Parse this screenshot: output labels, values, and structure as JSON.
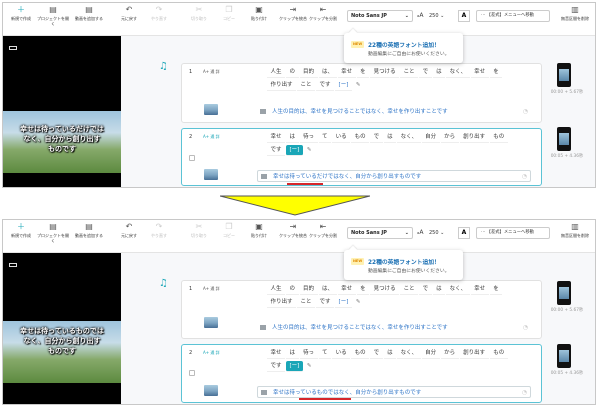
{
  "toolbar": {
    "new_project": "新規で作成",
    "open_project": "プロジェクトを開く",
    "add_video": "動画を追加する",
    "undo": "元に戻す",
    "redo": "やり直す",
    "cut": "切り取り",
    "copy": "コピー",
    "paste": "貼り付け",
    "clip_merge": "クリップを統合",
    "clip_split": "クリップを分割",
    "font": "Noto Sans JP",
    "font_size": "250",
    "color_btn": "A",
    "menu_btn": "【差式】メニューへ移動",
    "silence": "無音区間を削除"
  },
  "popup": {
    "badge": "NEW",
    "title": "22種の英語フォント追加！",
    "body": "動画編集にご自由にお使いください。"
  },
  "arrow_color": "#ffff00",
  "accent": "#1aa6b7",
  "before": {
    "overlay_lines": [
      "幸せは待っているだけでは",
      "なく、自分から創り出す",
      "ものです"
    ],
    "clip1": {
      "num": "1",
      "mode": "A+ 通 詳",
      "words": [
        "人生",
        "の",
        "目的",
        "は、",
        "幸せ",
        "を",
        "見つける",
        "こと",
        "で",
        "は",
        "なく、",
        "幸せ",
        "を",
        "作り出す",
        "こと",
        "です",
        "[ー]"
      ],
      "subtitle": "人生の目的は、幸せを見つけることではなく、幸せを作り出すことです",
      "duration": "00:00 + 5.67秒"
    },
    "clip2": {
      "num": "2",
      "mode": "A+ 通 詳",
      "words": [
        "幸せ",
        "は",
        "待っ",
        "て",
        "いる",
        "もの",
        "で",
        "は",
        "なく、",
        "自分",
        "から",
        "創り出す",
        "もの",
        "です",
        "[ー]"
      ],
      "subtitle": "幸せは待っているだけではなく、自分から創り出すものです",
      "duration": "00:05 + 4.36秒"
    }
  },
  "after": {
    "overlay_lines": [
      "幸せは待っているものでは",
      "なく、自分から創り出す",
      "ものです"
    ],
    "clip1": {
      "num": "1",
      "mode": "A+ 通 詳",
      "words": [
        "人生",
        "の",
        "目的",
        "は、",
        "幸せ",
        "を",
        "見つける",
        "こと",
        "で",
        "は",
        "なく、",
        "幸せ",
        "を",
        "作り出す",
        "こと",
        "です",
        "[ー]"
      ],
      "subtitle": "人生の目的は、幸せを見つけることではなく、幸せを作り出すことです",
      "duration": "00:00 + 5.67秒"
    },
    "clip2": {
      "num": "2",
      "mode": "A+ 通 詳",
      "words": [
        "幸せ",
        "は",
        "待っ",
        "て",
        "いる",
        "もの",
        "で",
        "は",
        "なく、",
        "自分",
        "から",
        "創り出す",
        "もの",
        "です",
        "[ー]"
      ],
      "subtitle": "幸せは待っているものではなく、自分から創り出すものです",
      "duration": "00:05 + 4.36秒"
    }
  }
}
